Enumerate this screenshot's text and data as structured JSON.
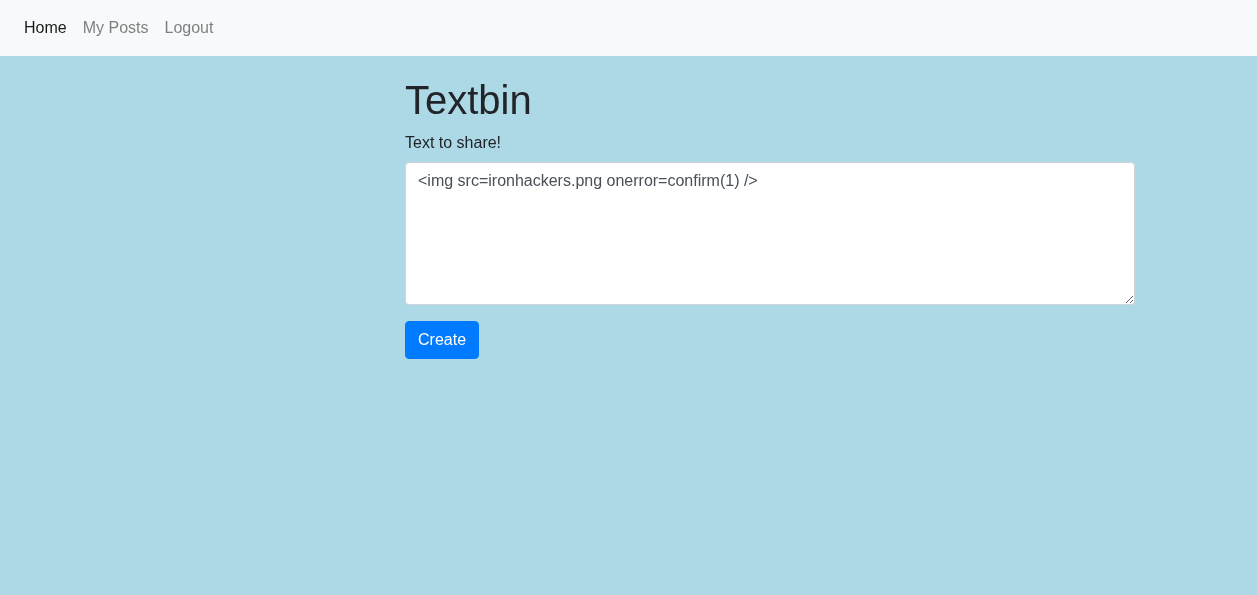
{
  "navbar": {
    "items": [
      {
        "label": "Home",
        "selected": true
      },
      {
        "label": "My Posts",
        "selected": false
      },
      {
        "label": "Logout",
        "selected": false
      }
    ]
  },
  "title": "Textbin",
  "form": {
    "label": "Text to share!",
    "value": "<img src=ironhackers.png onerror=confirm(1) />",
    "button": "Create"
  }
}
